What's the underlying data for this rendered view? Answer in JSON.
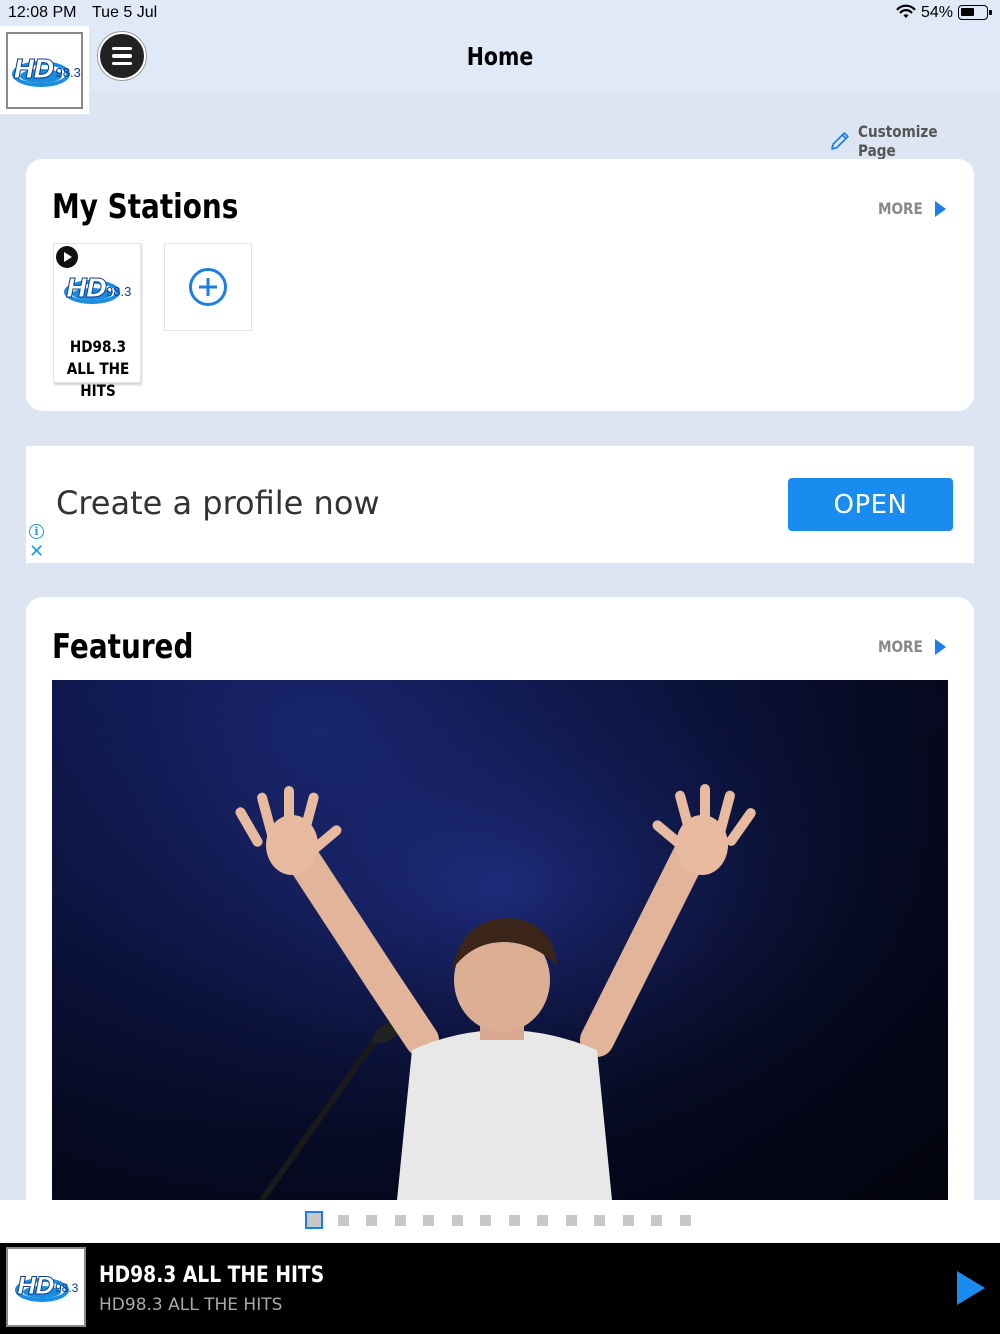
{
  "status_bar": {
    "time": "12:08 PM",
    "date": "Tue 5 Jul",
    "battery": "54%",
    "battery_level": 0.54
  },
  "header": {
    "title": "Home",
    "logo_text": "HD",
    "logo_number": "98.3"
  },
  "customize": {
    "label": "Customize Page"
  },
  "my_stations": {
    "title": "My Stations",
    "more_label": "MORE",
    "stations": [
      {
        "name": "HD98.3 ALL THE HITS",
        "logo_text": "HD",
        "logo_number": "98.3"
      }
    ]
  },
  "ad": {
    "text": "Create a profile now",
    "button_label": "OPEN",
    "info_glyph": "i",
    "close_glyph": "✕"
  },
  "featured": {
    "title": "Featured",
    "more_label": "MORE",
    "pager_count": 14,
    "pager_active_index": 0
  },
  "now_playing": {
    "title": "HD98.3 ALL THE HITS",
    "subtitle": "HD98.3 ALL THE HITS",
    "logo_text": "HD",
    "logo_number": "98.3"
  },
  "colors": {
    "accent": "#1a7fe8",
    "background": "#dde5f2",
    "player_bar": "#000000"
  },
  "icons": {
    "menu": "hamburger-icon",
    "customize": "pencil-icon",
    "more": "triangle-right-icon",
    "play": "play-icon",
    "add": "plus-circle-icon"
  }
}
